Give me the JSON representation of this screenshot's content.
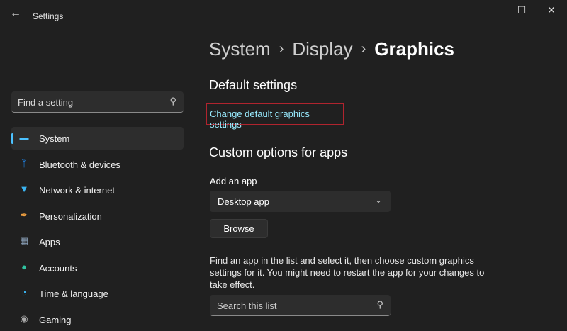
{
  "window": {
    "title": "Settings",
    "back_icon": "arrow-left-icon"
  },
  "search": {
    "placeholder": "Find a setting",
    "icon": "search-icon"
  },
  "sidebar": {
    "items": [
      {
        "label": "System",
        "icon": "monitor-icon",
        "color": "#4cc2ff"
      },
      {
        "label": "Bluetooth & devices",
        "icon": "bluetooth-icon",
        "color": "#1e90ff"
      },
      {
        "label": "Network & internet",
        "icon": "wifi-icon",
        "color": "#3ab4f2"
      },
      {
        "label": "Personalization",
        "icon": "brush-icon",
        "color": "#f0a040"
      },
      {
        "label": "Apps",
        "icon": "apps-icon",
        "color": "#8aa0b8"
      },
      {
        "label": "Accounts",
        "icon": "person-icon",
        "color": "#2fc2a0"
      },
      {
        "label": "Time & language",
        "icon": "clock-globe-icon",
        "color": "#3ab4f2"
      },
      {
        "label": "Gaming",
        "icon": "controller-icon",
        "color": "#aaaaaa"
      }
    ]
  },
  "breadcrumb": {
    "items": [
      "System",
      "Display",
      "Graphics"
    ]
  },
  "main": {
    "default_heading": "Default settings",
    "default_link": "Change default graphics settings",
    "custom_heading": "Custom options for apps",
    "add_label": "Add an app",
    "app_type": "Desktop app",
    "browse": "Browse",
    "description": "Find an app in the list and select it, then choose custom graphics settings for it. You might need to restart the app for your changes to take effect.",
    "list_search_placeholder": "Search this list"
  }
}
